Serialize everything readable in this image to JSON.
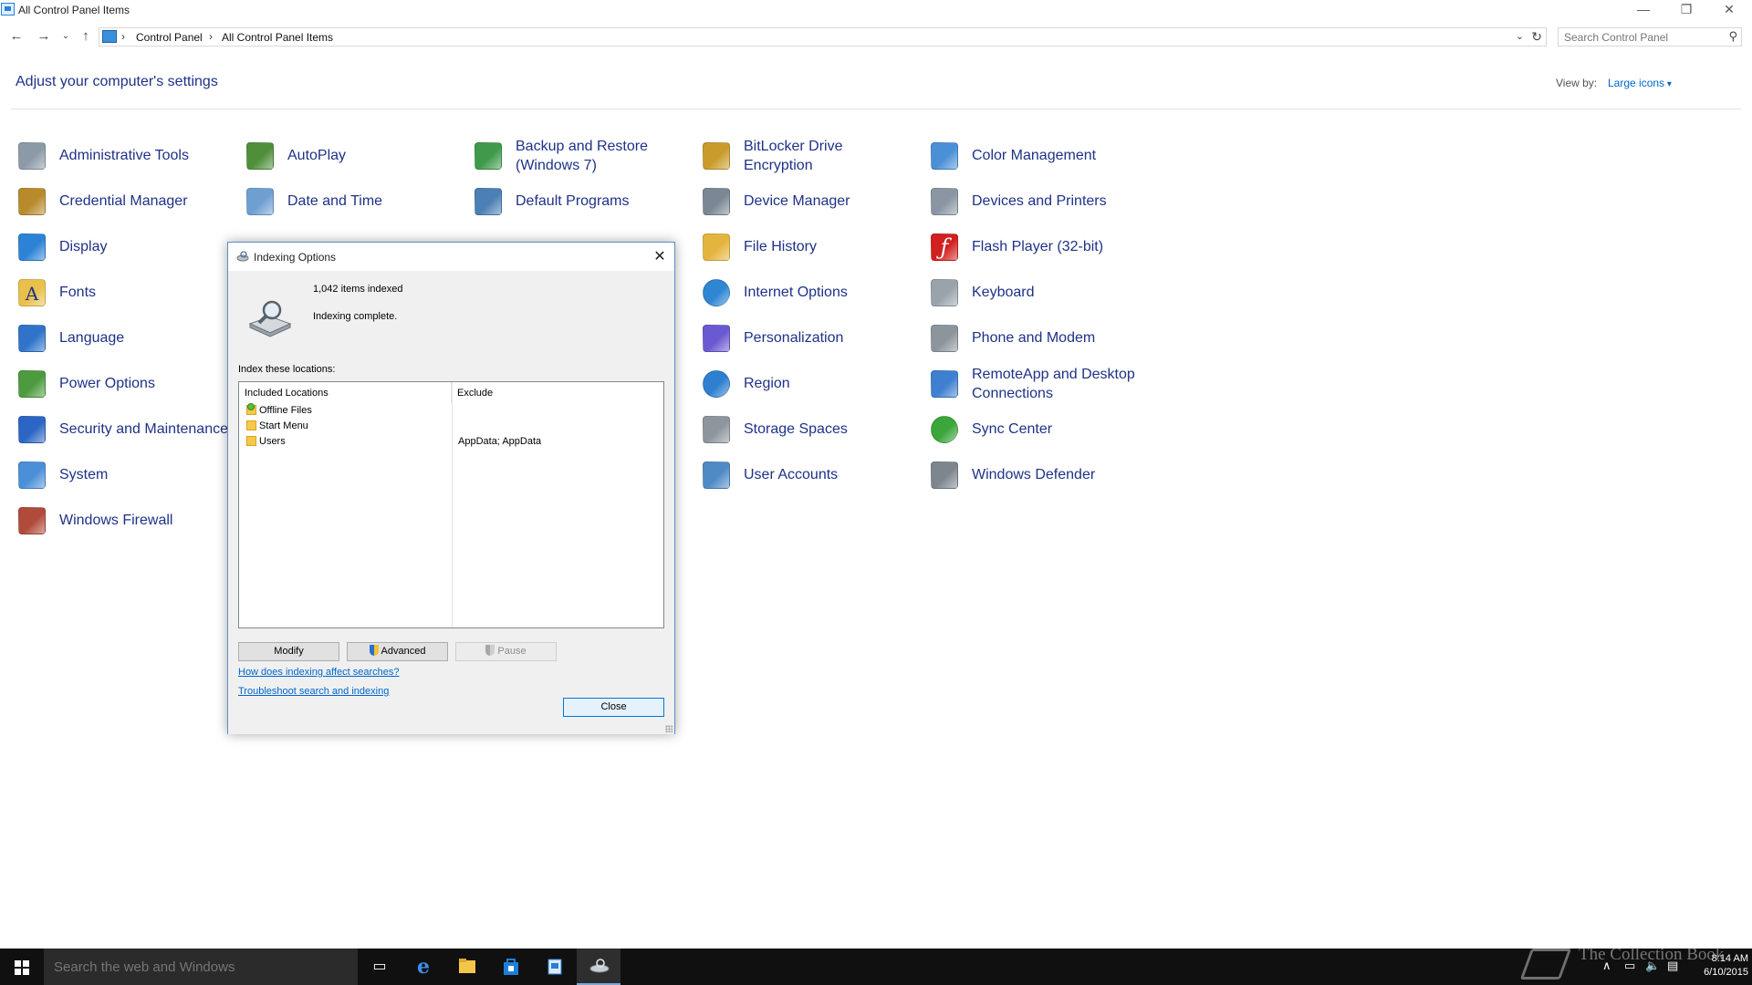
{
  "window": {
    "title": "All Control Panel Items",
    "minimize": "—",
    "restore": "❐",
    "close": "✕"
  },
  "address": {
    "crumbs": [
      "Control Panel",
      "All Control Panel Items"
    ],
    "search_placeholder": "Search Control Panel"
  },
  "page": {
    "heading": "Adjust your computer's settings",
    "view_by_label": "View by:",
    "view_by_value": "Large icons"
  },
  "items": [
    {
      "label": "Administrative Tools",
      "icon": "tools-icon"
    },
    {
      "label": "AutoPlay",
      "icon": "autoplay-icon"
    },
    {
      "label": "Backup and Restore (Windows 7)",
      "icon": "backup-icon"
    },
    {
      "label": "BitLocker Drive Encryption",
      "icon": "bitlocker-icon"
    },
    {
      "label": "Color Management",
      "icon": "color-management-icon"
    },
    {
      "label": "Credential Manager",
      "icon": "credential-icon"
    },
    {
      "label": "Date and Time",
      "icon": "calendar-icon"
    },
    {
      "label": "Default Programs",
      "icon": "default-programs-icon"
    },
    {
      "label": "Device Manager",
      "icon": "device-manager-icon"
    },
    {
      "label": "Devices and Printers",
      "icon": "printer-icon"
    },
    {
      "label": "Display",
      "icon": "monitor-icon"
    },
    {
      "label": "File History",
      "icon": "file-history-icon"
    },
    {
      "label": "Flash Player (32-bit)",
      "icon": "flash-icon"
    },
    {
      "label": "Fonts",
      "icon": "fonts-icon"
    },
    {
      "label": "Internet Options",
      "icon": "globe-icon"
    },
    {
      "label": "Keyboard",
      "icon": "keyboard-icon"
    },
    {
      "label": "Language",
      "icon": "language-icon"
    },
    {
      "label": "Personalization",
      "icon": "personalization-icon"
    },
    {
      "label": "Phone and Modem",
      "icon": "phone-icon"
    },
    {
      "label": "Power Options",
      "icon": "power-icon"
    },
    {
      "label": "Region",
      "icon": "region-icon"
    },
    {
      "label": "RemoteApp and Desktop Connections",
      "icon": "remoteapp-icon"
    },
    {
      "label": "Security and Maintenance",
      "icon": "flag-icon"
    },
    {
      "label": "Storage Spaces",
      "icon": "storage-icon"
    },
    {
      "label": "Sync Center",
      "icon": "sync-icon"
    },
    {
      "label": "System",
      "icon": "system-icon"
    },
    {
      "label": "User Accounts",
      "icon": "users-icon"
    },
    {
      "label": "Windows Defender",
      "icon": "defender-icon"
    },
    {
      "label": "Windows Firewall",
      "icon": "firewall-icon"
    }
  ],
  "dialog": {
    "title": "Indexing Options",
    "items_indexed": "1,042 items indexed",
    "status": "Indexing complete.",
    "locations_label": "Index these locations:",
    "columns": [
      "Included Locations",
      "Exclude"
    ],
    "rows": [
      {
        "name": "Offline Files",
        "exclude": ""
      },
      {
        "name": "Start Menu",
        "exclude": ""
      },
      {
        "name": "Users",
        "exclude": "AppData; AppData"
      }
    ],
    "modify": "Modify",
    "advanced": "Advanced",
    "pause": "Pause",
    "link_affect": "How does indexing affect searches?",
    "link_troubleshoot": "Troubleshoot search and indexing",
    "close": "Close"
  },
  "taskbar": {
    "search_placeholder": "Search the web and Windows",
    "time": "8:14 AM",
    "date": "6/10/2015",
    "watermark": "The Collection Book"
  }
}
